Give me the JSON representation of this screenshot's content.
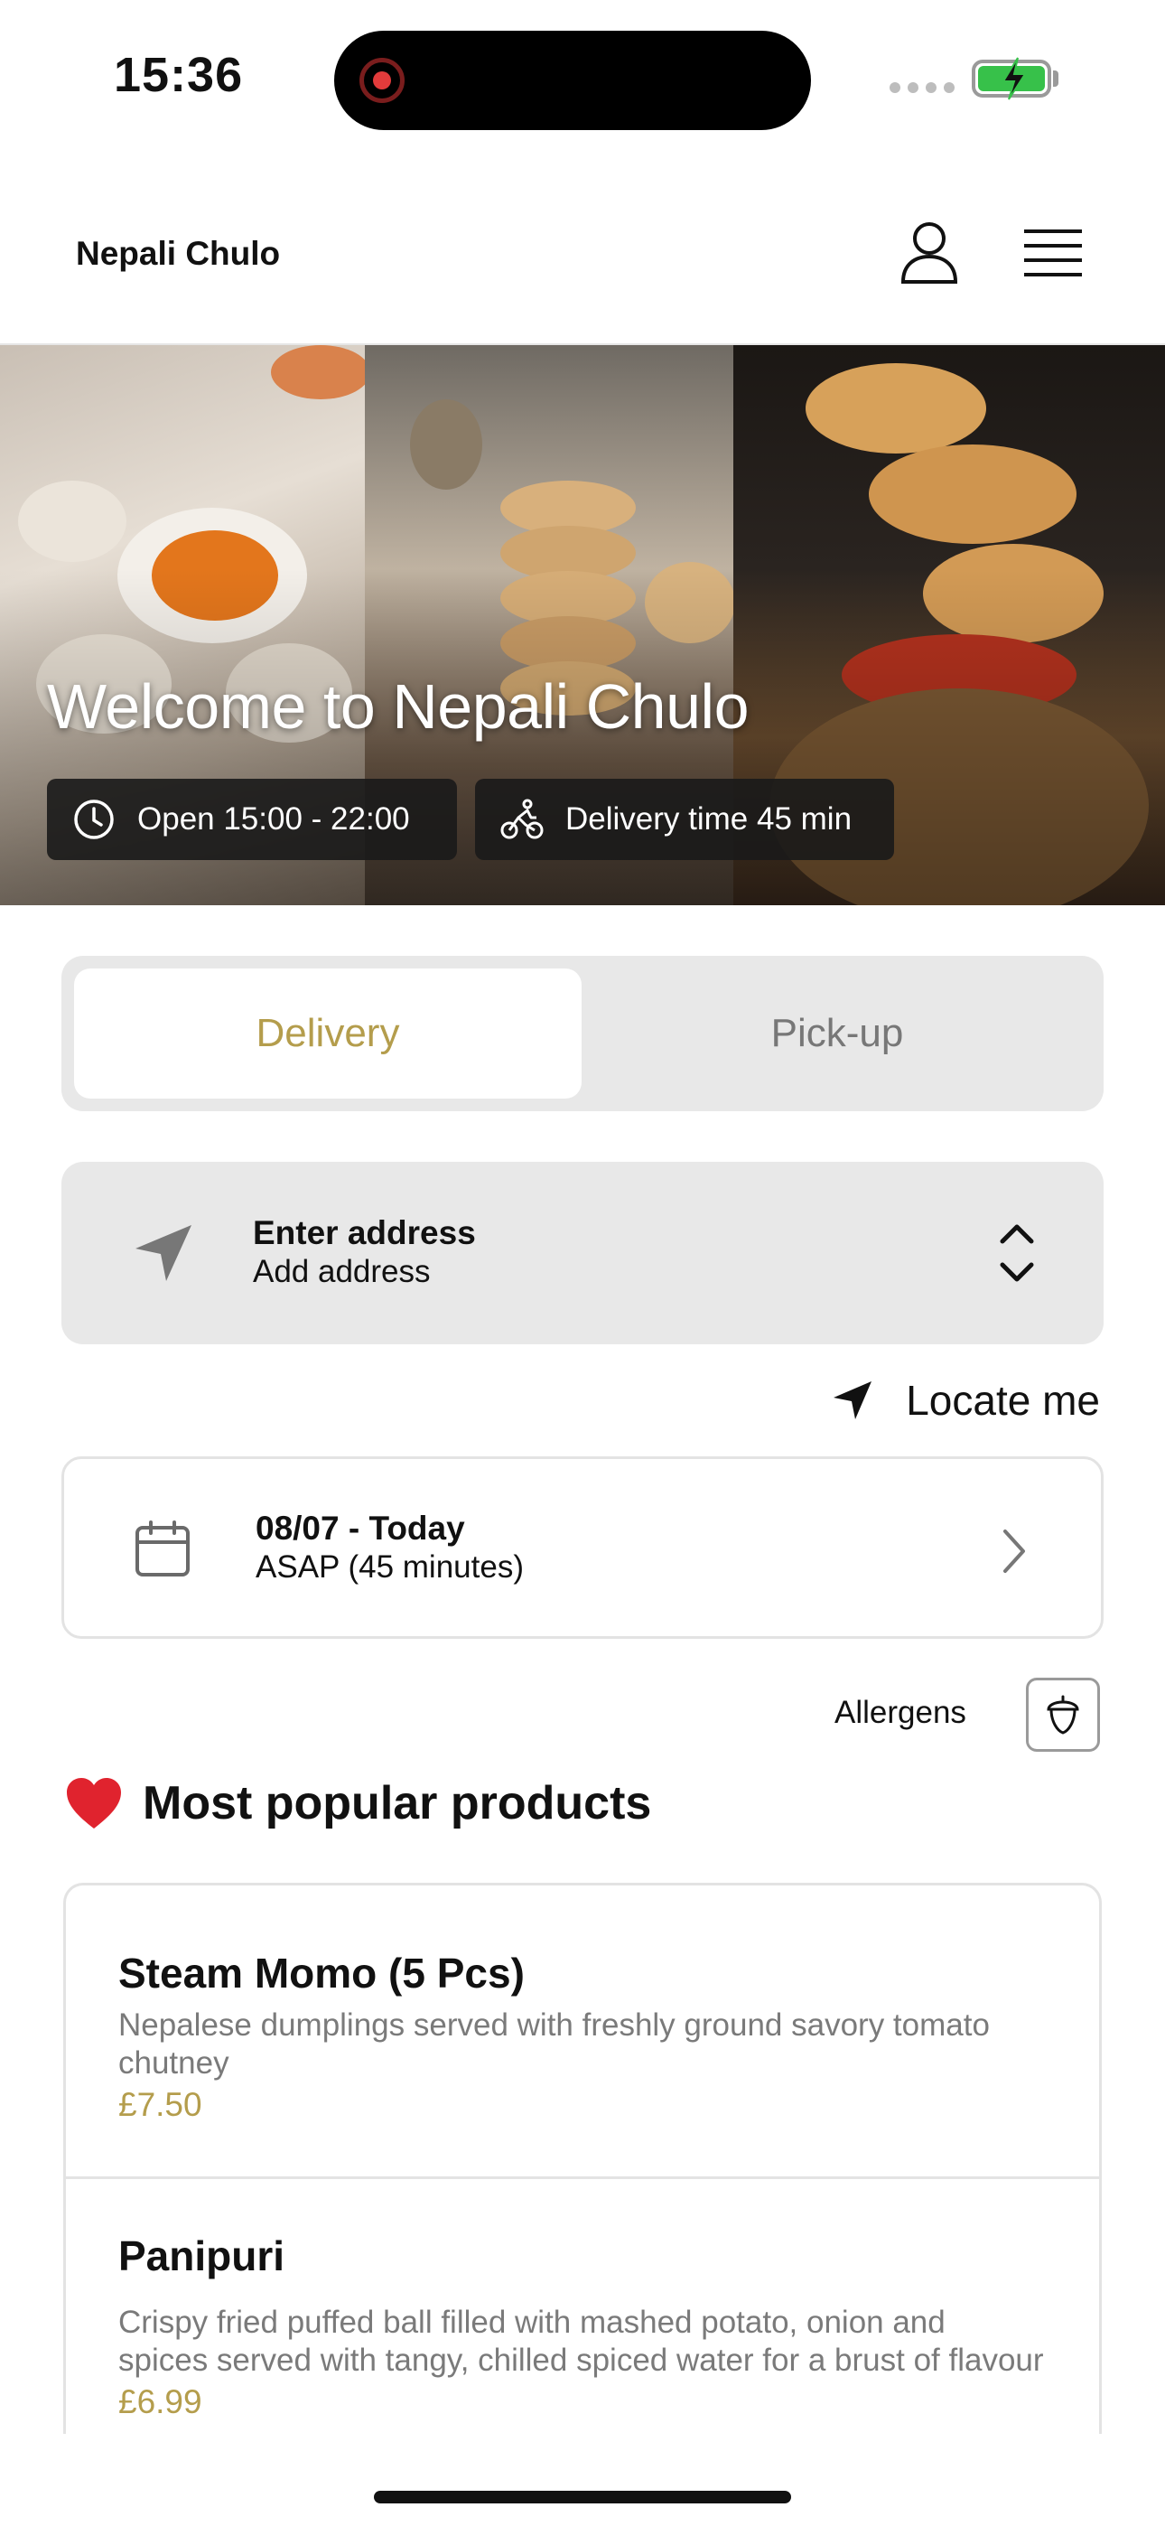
{
  "status_bar": {
    "time": "15:36"
  },
  "header": {
    "brand": "Nepali Chulo"
  },
  "hero": {
    "title": "Welcome to Nepali Chulo",
    "open_hours": "Open 15:00 - 22:00",
    "delivery_time": "Delivery time 45 min"
  },
  "order_mode": {
    "options": [
      "Delivery",
      "Pick-up"
    ],
    "selected": "Delivery"
  },
  "address": {
    "title": "Enter address",
    "subtitle": "Add address"
  },
  "locate_label": "Locate me",
  "schedule": {
    "date": "08/07 - Today",
    "time": "ASAP (45 minutes)"
  },
  "allergens_label": "Allergens",
  "popular": {
    "title": "Most popular products",
    "products": [
      {
        "name": "Steam Momo (5 Pcs)",
        "description": "Nepalese dumplings served with freshly ground savory tomato chutney",
        "price": "£7.50"
      },
      {
        "name": "Panipuri",
        "description_line1": "Crispy fried puffed ball filled with mashed potato, onion and",
        "description_line2": "spices served with tangy, chilled spiced water for a brust of flavour",
        "price": "£6.99"
      }
    ]
  },
  "colors": {
    "accent": "#b49d4c",
    "surface": "#e8e8e8",
    "border": "#e3e3e3"
  }
}
